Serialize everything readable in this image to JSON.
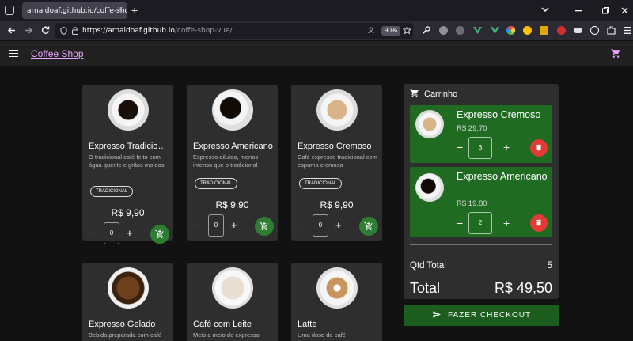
{
  "browser": {
    "tab_title": "arnaldoaf.github.io/coffe-shop-vue/",
    "tab_close": "×",
    "new_tab": "+",
    "url_host": "https://arnaldoaf.github.io",
    "url_path": "/coffe-shop-vue/",
    "zoom": "90%",
    "icons": [
      "back-icon",
      "forward-icon",
      "reload-icon",
      "shield-icon",
      "lock-icon",
      "translate-icon",
      "star-icon",
      "extensions-icon",
      "menu-icon"
    ]
  },
  "app": {
    "title": "Coffee Shop",
    "accent": "#e9a6ff",
    "success": "#2e7d32",
    "danger": "#e53935"
  },
  "products": [
    {
      "name": "Expresso Tradicional",
      "desc": "O tradicional café feito com água quente e grãos moídos",
      "tag": "TRADICIONAL",
      "price": "R$ 9,90",
      "qty": "0"
    },
    {
      "name": "Expresso Americano",
      "desc": "Expresso diluído, menos intenso que o tradicional",
      "tag": "TRADICIONAL",
      "price": "R$ 9,90",
      "qty": "0"
    },
    {
      "name": "Expresso Cremoso",
      "desc": "Café expresso tradicional com espuma cremosa",
      "tag": "TRADICIONAL",
      "price": "R$ 9,90",
      "qty": "0"
    },
    {
      "name": "Expresso Gelado",
      "desc": "Bebida preparada com café"
    },
    {
      "name": "Café com Leite",
      "desc": "Meio a meio de expresso"
    },
    {
      "name": "Latte",
      "desc": "Uma dose de café"
    }
  ],
  "cart": {
    "title": "Carrinho",
    "items": [
      {
        "name": "Expresso Cremoso",
        "price": "R$ 29,70",
        "qty": "3"
      },
      {
        "name": "Expresso Americano",
        "price": "R$ 19,80",
        "qty": "2"
      }
    ],
    "qtd_label": "Qtd Total",
    "qtd_value": "5",
    "total_label": "Total",
    "total_value": "R$ 49,50"
  },
  "controls": {
    "minus": "−",
    "plus": "+"
  },
  "checkout_label": "FAZER CHECKOUT"
}
